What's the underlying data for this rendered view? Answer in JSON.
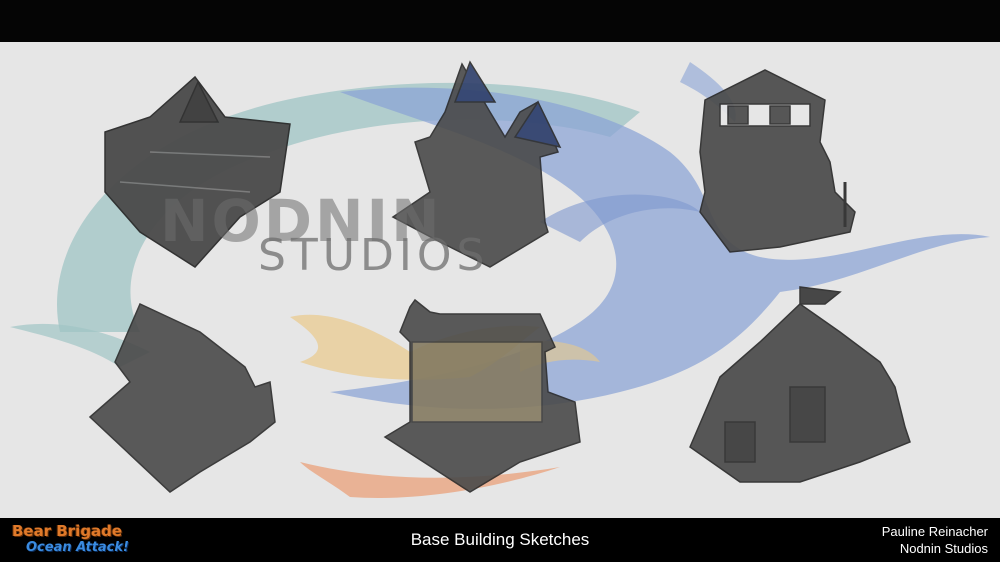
{
  "caption": "Base Building Sketches",
  "watermark": {
    "line1": "NODNIN",
    "line2": "STUDIOS"
  },
  "logo": {
    "line1": "Bear Brigade",
    "line2": "Ocean Attack!"
  },
  "credits": {
    "author": "Pauline Reinacher",
    "studio": "Nodnin Studios"
  },
  "colors": {
    "background": "#e6e6e6",
    "wave_teal": "#9fc4c4",
    "wave_blue": "#8aa3d6",
    "wave_orange": "#e9b27a",
    "sketch": "#4a4a4a"
  }
}
